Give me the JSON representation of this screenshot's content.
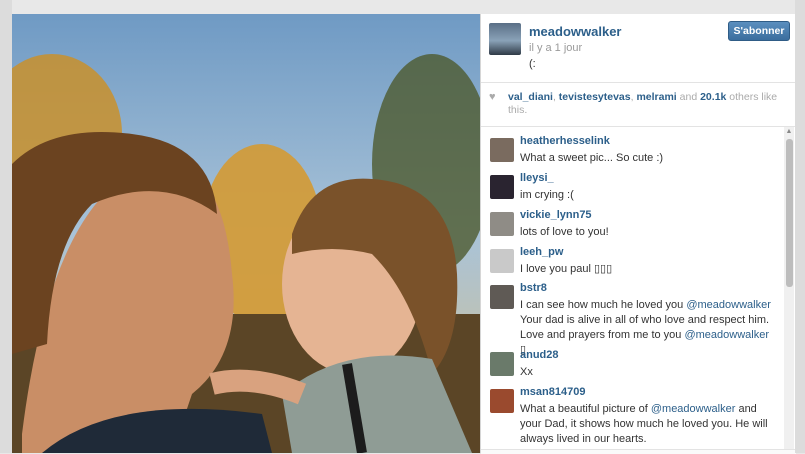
{
  "post": {
    "username": "meadowwalker",
    "time": "il y a 1 jour",
    "caption": "(:",
    "follow_label": "S'abonner"
  },
  "likes": {
    "users": [
      "val_diani",
      "tevistesytevas",
      "melrami"
    ],
    "sep1": ", ",
    "sep2": ", ",
    "suffix_and": " and ",
    "count": "20.1k",
    "suffix_rest": " others like this."
  },
  "comments": [
    {
      "user": "heatherhesselink",
      "text": "What a sweet pic... So cute :)",
      "avatar_color": "#7a6b5f"
    },
    {
      "user": "lleysi_",
      "text": "im crying :(",
      "avatar_color": "#2a2430"
    },
    {
      "user": "vickie_lynn75",
      "text": "lots of love to you!",
      "avatar_color": "#8f8c86"
    },
    {
      "user": "leeh_pw",
      "text": "I love you paul ▯▯▯",
      "avatar_color": "#c9c9c9"
    },
    {
      "user": "bstr8",
      "text_before": "I can see how much he loved you ",
      "mention1": "@meadowwalker",
      "text_mid": " Your dad is alive in all of who love and respect him. Love and prayers from me to you ",
      "mention2": "@meadowwalker",
      "text_end": " ▯",
      "avatar_color": "#5f5a55"
    },
    {
      "user": "anud28",
      "text": "Xx",
      "avatar_color": "#6a7a6a"
    },
    {
      "user": "msan814709",
      "text_before": "What a beautiful picture of ",
      "mention1": "@meadowwalker",
      "text_end": " and your Dad, it shows how much he loved you. He will always lived in our hearts.",
      "avatar_color": "#9a4a2e"
    }
  ]
}
